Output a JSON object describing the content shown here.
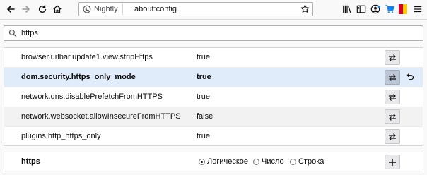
{
  "toolbar": {
    "identity_label": "Nightly",
    "url": "about:config"
  },
  "search": {
    "value": "https"
  },
  "prefs": [
    {
      "name": "browser.urlbar.update1.view.stripHttps",
      "value": "true",
      "modified": false
    },
    {
      "name": "dom.security.https_only_mode",
      "value": "true",
      "modified": true
    },
    {
      "name": "network.dns.disablePrefetchFromHTTPS",
      "value": "true",
      "modified": false
    },
    {
      "name": "network.websocket.allowInsecureFromHTTPS",
      "value": "false",
      "modified": false
    },
    {
      "name": "plugins.http_https_only",
      "value": "true",
      "modified": false
    }
  ],
  "add_row": {
    "name": "https",
    "types": [
      {
        "label": "Логическое",
        "selected": true
      },
      {
        "label": "Число",
        "selected": false
      },
      {
        "label": "Строка",
        "selected": false
      }
    ]
  },
  "colors": {
    "modified_row": "#e0ecfa",
    "accent_red": "#d70022",
    "accent_yellow": "#ffcc00"
  },
  "icons": [
    "back-icon",
    "forward-icon",
    "reload-icon",
    "home-icon",
    "nightly-icon",
    "star-icon",
    "library-icon",
    "sidebar-icon",
    "account-icon",
    "cart-icon",
    "flag-icon",
    "menu-icon",
    "search-icon",
    "toggle-icon",
    "reset-icon",
    "add-icon"
  ]
}
